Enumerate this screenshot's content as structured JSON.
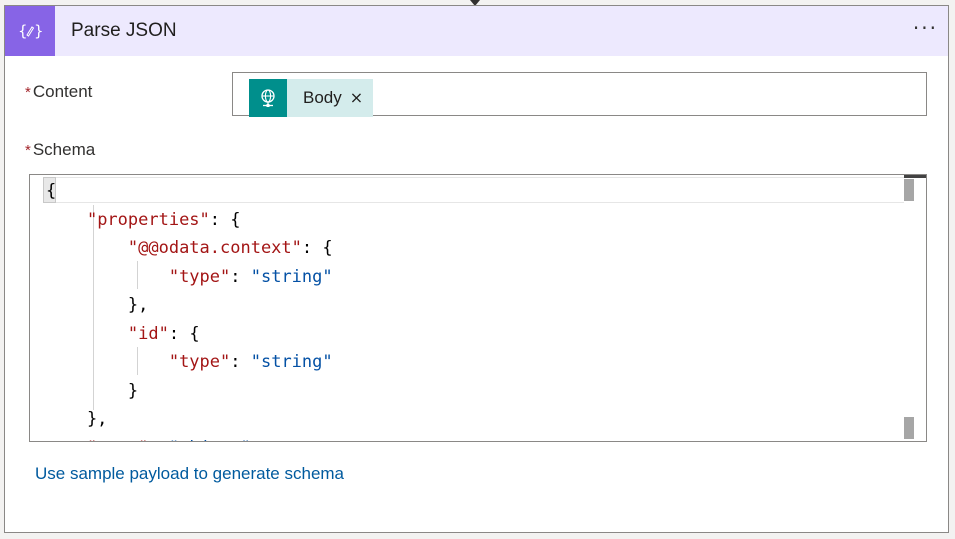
{
  "action": {
    "title": "Parse JSON",
    "menu_label": "···",
    "icon": "braces-pencil-icon",
    "accent_color": "#8764e6",
    "header_bg": "#ede9fe"
  },
  "content_field": {
    "required_mark": "*",
    "label": "Content",
    "token": {
      "label": "Body",
      "icon": "globe-network-icon",
      "icon_bg": "#008f8c",
      "close_glyph": "×"
    }
  },
  "schema_field": {
    "required_mark": "*",
    "label": "Schema",
    "code_lines": [
      [
        {
          "t": "p",
          "v": "{"
        }
      ],
      [
        {
          "t": "p",
          "v": "    "
        },
        {
          "t": "k",
          "v": "\"properties\""
        },
        {
          "t": "p",
          "v": ": {"
        }
      ],
      [
        {
          "t": "p",
          "v": "        "
        },
        {
          "t": "k",
          "v": "\"@@odata.context\""
        },
        {
          "t": "p",
          "v": ": {"
        }
      ],
      [
        {
          "t": "p",
          "v": "            "
        },
        {
          "t": "k",
          "v": "\"type\""
        },
        {
          "t": "p",
          "v": ": "
        },
        {
          "t": "s",
          "v": "\"string\""
        }
      ],
      [
        {
          "t": "p",
          "v": "        },"
        }
      ],
      [
        {
          "t": "p",
          "v": "        "
        },
        {
          "t": "k",
          "v": "\"id\""
        },
        {
          "t": "p",
          "v": ": {"
        }
      ],
      [
        {
          "t": "p",
          "v": "            "
        },
        {
          "t": "k",
          "v": "\"type\""
        },
        {
          "t": "p",
          "v": ": "
        },
        {
          "t": "s",
          "v": "\"string\""
        }
      ],
      [
        {
          "t": "p",
          "v": "        }"
        }
      ],
      [
        {
          "t": "p",
          "v": "    },"
        }
      ],
      [
        {
          "t": "p",
          "v": "    "
        },
        {
          "t": "k",
          "v": "\"type\""
        },
        {
          "t": "p",
          "v": ": "
        },
        {
          "t": "s",
          "v": "\"object\""
        }
      ]
    ]
  },
  "sample_payload_link": "Use sample payload to generate schema"
}
